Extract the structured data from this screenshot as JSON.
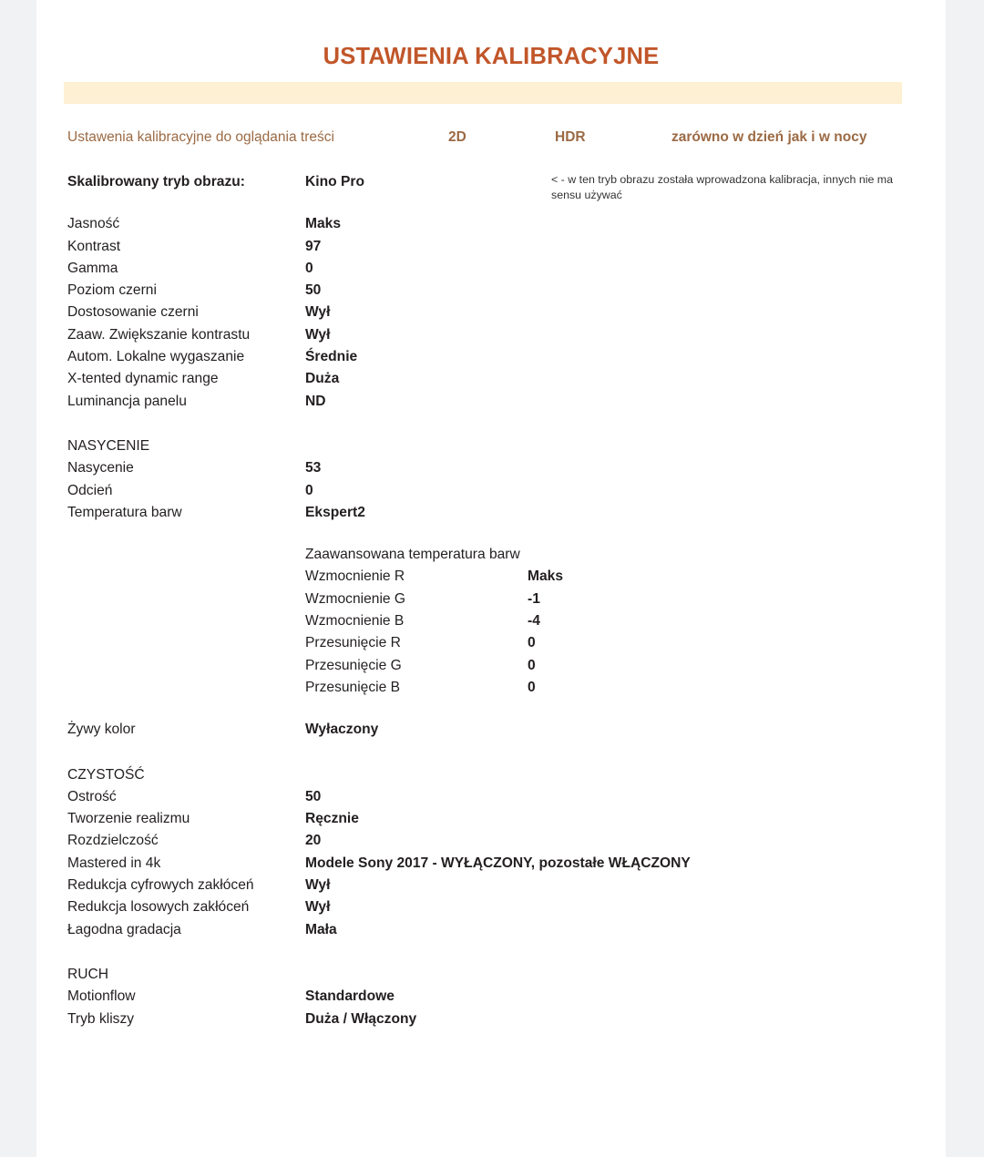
{
  "document": {
    "title": "USTAWIENIA KALIBRACYJNE",
    "subtitle": {
      "lead": "Ustawenia kalibracyjne do oglądania treści",
      "format_2d": "2D",
      "format_hdr": "HDR",
      "conditions": "zarówno w dzień jak i w nocy"
    },
    "picture_mode": {
      "label": "Skalibrowany tryb obrazu:",
      "value": "Kino Pro",
      "note": "< - w ten tryb obrazu została wprowadzona kalibracja, innych nie ma sensu używać"
    },
    "basic_settings": [
      {
        "label": "Jasność",
        "value": "Maks"
      },
      {
        "label": "Kontrast",
        "value": "97"
      },
      {
        "label": "Gamma",
        "value": "0"
      },
      {
        "label": "Poziom czerni",
        "value": "50"
      },
      {
        "label": "Dostosowanie czerni",
        "value": "Wył"
      },
      {
        "label": "Zaaw. Zwiększanie kontrastu",
        "value": "Wył"
      },
      {
        "label": "Autom. Lokalne wygaszanie",
        "value": "Średnie"
      },
      {
        "label": "X-tented dynamic range",
        "value": "Duża"
      },
      {
        "label": "Luminancja panelu",
        "value": "ND"
      }
    ],
    "saturation_section": {
      "heading": "NASYCENIE",
      "rows": [
        {
          "label": "Nasycenie",
          "value": "53"
        },
        {
          "label": "Odcień",
          "value": "0"
        },
        {
          "label": "Temperatura barw",
          "value": "Ekspert2"
        }
      ]
    },
    "advanced_color_temp": {
      "heading": "Zaawansowana temperatura barw",
      "rows": [
        {
          "label": "Wzmocnienie R",
          "value": "Maks"
        },
        {
          "label": "Wzmocnienie G",
          "value": "-1"
        },
        {
          "label": "Wzmocnienie B",
          "value": "-4"
        },
        {
          "label": "Przesunięcie R",
          "value": "0"
        },
        {
          "label": "Przesunięcie G",
          "value": "0"
        },
        {
          "label": "Przesunięcie B",
          "value": "0"
        }
      ]
    },
    "live_color": {
      "label": "Żywy kolor",
      "value": "Wyłaczony"
    },
    "clarity_section": {
      "heading": "CZYSTOŚĆ",
      "rows": [
        {
          "label": "Ostrość",
          "value": "50"
        },
        {
          "label": "Tworzenie realizmu",
          "value": "Ręcznie"
        },
        {
          "label": "Rozdzielczość",
          "value": "20"
        },
        {
          "label": "Mastered in 4k",
          "value": "Modele Sony 2017 - WYŁĄCZONY, pozostałe WŁĄCZONY"
        },
        {
          "label": "Redukcja cyfrowych zakłóceń",
          "value": "Wył"
        },
        {
          "label": "Redukcja losowych zakłóceń",
          "value": "Wył"
        },
        {
          "label": "Łagodna gradacja",
          "value": "Mała"
        }
      ]
    },
    "motion_section": {
      "heading": "RUCH",
      "rows": [
        {
          "label": "Motionflow",
          "value": "Standardowe"
        },
        {
          "label": "Tryb kliszy",
          "value": "Duża / Włączony"
        }
      ]
    },
    "colors": {
      "title": "#c1562a",
      "subtitle_text": "#9b6a44",
      "highlight_band": "#fdf0d3",
      "page_background": "#ffffff",
      "canvas_background": "#f1f2f4",
      "body_text": "#231f20"
    }
  }
}
